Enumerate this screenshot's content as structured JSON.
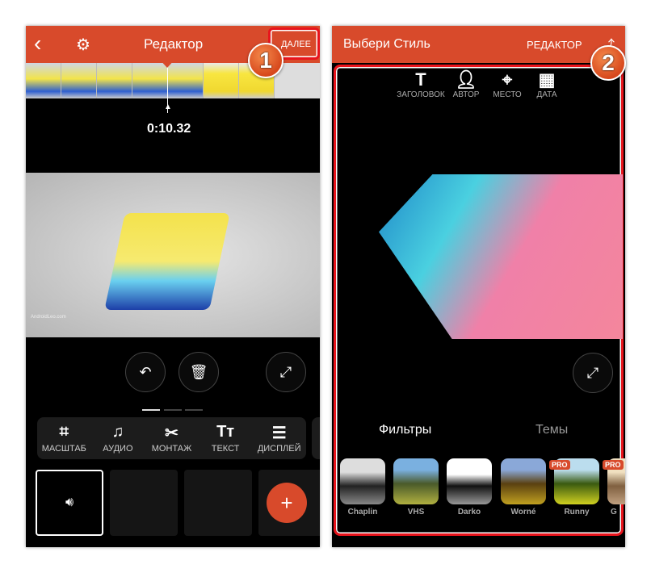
{
  "left": {
    "header": {
      "title": "Редактор",
      "next": "ДАЛЕЕ",
      "back_icon": "arrow-left-icon",
      "settings_icon": "gear-icon"
    },
    "time": "0:10.32",
    "toolbar": [
      {
        "label": "МАСШТАБ",
        "icon": "crop-icon"
      },
      {
        "label": "АУДИО",
        "icon": "music-note-icon"
      },
      {
        "label": "МОНТАЖ",
        "icon": "scissors-icon"
      },
      {
        "label": "ТЕКСТ",
        "icon": "text-icon"
      },
      {
        "label": "ДИСПЛЕЙ",
        "icon": "sliders-icon"
      }
    ],
    "video_caption": "AndroidLeo.com"
  },
  "right": {
    "header": {
      "title": "Выбери Стиль",
      "editor": "РЕДАКТОР",
      "share_icon": "share-icon"
    },
    "overlays": [
      {
        "label": "ЗАГОЛОВОК",
        "icon": "title-icon"
      },
      {
        "label": "АВТОР",
        "icon": "person-icon"
      },
      {
        "label": "МЕСТО",
        "icon": "location-pin-icon"
      },
      {
        "label": "ДАТА",
        "icon": "calendar-icon"
      }
    ],
    "tabs": [
      "Фильтры",
      "Темы"
    ],
    "filters": [
      {
        "name": "Chaplin",
        "pro": false
      },
      {
        "name": "VHS",
        "pro": false
      },
      {
        "name": "Darko",
        "pro": false
      },
      {
        "name": "Worné",
        "pro": false
      },
      {
        "name": "Runny",
        "pro": true
      },
      {
        "name": "G",
        "pro": true
      }
    ],
    "pro_label": "PRO"
  },
  "badges": [
    "1",
    "2"
  ],
  "colors": {
    "accent": "#d84a2b",
    "highlight": "#e8141c"
  }
}
